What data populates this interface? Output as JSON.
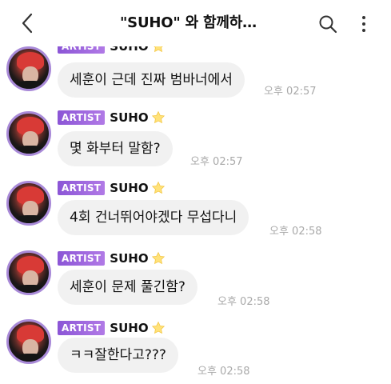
{
  "header": {
    "title": "\"SUHO\" 와 함께하…"
  },
  "messages": [
    {
      "badge": "ARTIST",
      "sender": "SUHO",
      "text": "세훈이 근데 진짜 범바너에서",
      "time": "오후 02:57"
    },
    {
      "badge": "ARTIST",
      "sender": "SUHO",
      "text": "몇 화부터 말함?",
      "time": "오후 02:57"
    },
    {
      "badge": "ARTIST",
      "sender": "SUHO",
      "text": "4회 건너뛰어야겠다 무섭다니",
      "time": "오후 02:58"
    },
    {
      "badge": "ARTIST",
      "sender": "SUHO",
      "text": "세훈이 문제 풀긴함?",
      "time": "오후 02:58"
    },
    {
      "badge": "ARTIST",
      "sender": "SUHO",
      "text": "ㅋㅋ잘한다고???",
      "time": "오후 02:58"
    }
  ],
  "colors": {
    "badge": "#9a66dd",
    "bubble": "#f1f1f1",
    "avatar_ring": "#a98ad8",
    "timestamp": "#a9a9a9"
  },
  "icons": {
    "back": "chevron-left-icon",
    "search": "search-icon",
    "more": "more-vertical-icon",
    "star": "star-icon"
  }
}
